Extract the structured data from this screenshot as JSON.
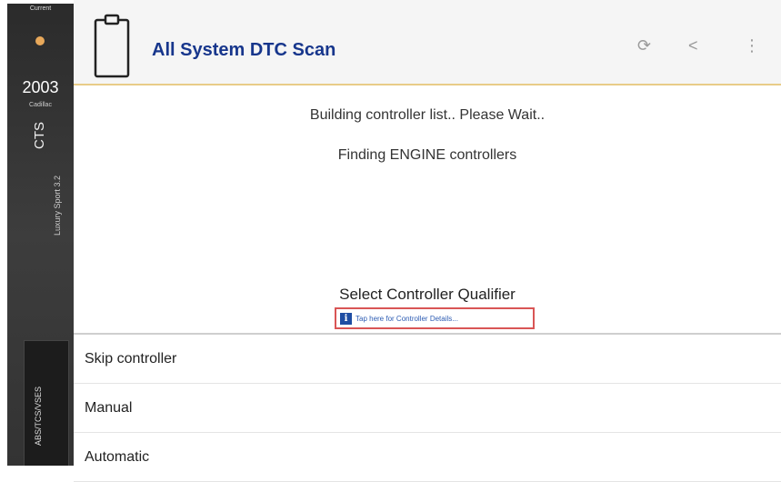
{
  "vehicle": {
    "top_label": "Current",
    "year": "2003",
    "make": "Cadillac",
    "model": "CTS",
    "trim": "Luxury Sport 3.2",
    "module": "ABS/TCS/VSES",
    "accent_color": "#e8a85a"
  },
  "header": {
    "title": "All System DTC Scan",
    "title_color": "#17368c",
    "icons": [
      "clipboard-icon",
      "refresh-icon",
      "back-icon",
      "more-icon"
    ],
    "refresh_glyph": "⟳",
    "back_glyph": "<",
    "menu_glyph": "⋮"
  },
  "main": {
    "status_line_1": "Building controller list.. Please Wait..",
    "status_line_2": "Finding ENGINE controllers",
    "qualifier_title": "Select Controller Qualifier",
    "details_link": "Tap here for Controller Details...",
    "info_glyph": "i"
  },
  "options": [
    {
      "label": "Skip controller"
    },
    {
      "label": "Manual"
    },
    {
      "label": "Automatic"
    }
  ]
}
